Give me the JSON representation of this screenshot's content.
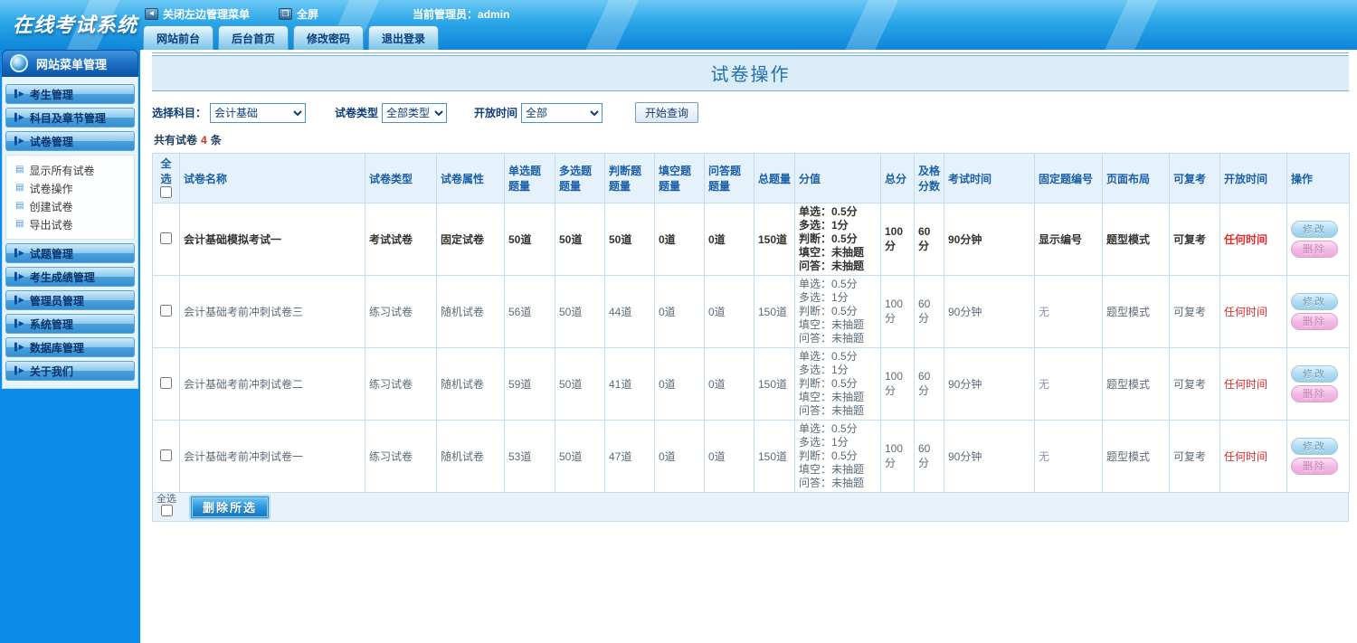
{
  "colors": {
    "topbar": "#1694e0",
    "sidebar": "#0a8ce8",
    "accent_red": "#e02b2b",
    "title_blue": "#2270ae"
  },
  "header": {
    "logo": "在线考试系统",
    "collapse_menu": "关闭左边管理菜单",
    "fullscreen": "全屏",
    "admin_text": "当前管理员：admin",
    "tabs": [
      "网站前台",
      "后台首页",
      "修改密码",
      "退出登录"
    ]
  },
  "sidebar": {
    "title": "网站菜单管理",
    "items": [
      "考生管理",
      "科目及章节管理",
      "试卷管理",
      "试题管理",
      "考生成绩管理",
      "管理员管理",
      "系统管理",
      "数据库管理",
      "关于我们"
    ],
    "submenu": [
      "显示所有试卷",
      "试卷操作",
      "创建试卷",
      "导出试卷"
    ]
  },
  "main": {
    "title": "试卷操作",
    "filters": {
      "subject_label": "选择科目：",
      "subject_value": "会计基础",
      "type_label": "试卷类型",
      "type_value": "全部类型",
      "time_label": "开放时间",
      "time_value": "全部",
      "query_button": "开始查询"
    },
    "count": {
      "prefix": "共有试卷",
      "number": "4",
      "suffix": "条"
    },
    "table": {
      "headers": [
        "全选",
        "试卷名称",
        "试卷类型",
        "试卷属性",
        "单选题题量",
        "多选题题量",
        "判断题题量",
        "填空题题量",
        "问答题题量",
        "总题量",
        "分值",
        "总分",
        "及格分数",
        "考试时间",
        "固定题编号",
        "页面布局",
        "可复考",
        "开放时间",
        "操作"
      ],
      "edit_label": "修改",
      "delete_label": "删除",
      "rows": [
        {
          "name": "会计基础模拟考试一",
          "type": "考试试卷",
          "attr": "固定试卷",
          "single": "50道",
          "multi": "50道",
          "judge": "50道",
          "blank": "0道",
          "qa": "0道",
          "total_q": "150道",
          "scores": "单选：0.5分\n多选：1分\n判断：0.5分\n填空：未抽题\n问答：未抽题",
          "total_score": "100分",
          "pass_score": "60分",
          "duration": "90分钟",
          "fixed_num": "显示编号",
          "layout": "题型模式",
          "retake": "可复考",
          "open_time": "任何时间"
        },
        {
          "name": "会计基础考前冲刺试卷三",
          "type": "练习试卷",
          "attr": "随机试卷",
          "single": "56道",
          "multi": "50道",
          "judge": "44道",
          "blank": "0道",
          "qa": "0道",
          "total_q": "150道",
          "scores": "单选：0.5分\n多选：1分\n判断：0.5分\n填空：未抽题\n问答：未抽题",
          "total_score": "100分",
          "pass_score": "60分",
          "duration": "90分钟",
          "fixed_num": "无",
          "layout": "题型模式",
          "retake": "可复考",
          "open_time": "任何时间"
        },
        {
          "name": "会计基础考前冲刺试卷二",
          "type": "练习试卷",
          "attr": "随机试卷",
          "single": "59道",
          "multi": "50道",
          "judge": "41道",
          "blank": "0道",
          "qa": "0道",
          "total_q": "150道",
          "scores": "单选：0.5分\n多选：1分\n判断：0.5分\n填空：未抽题\n问答：未抽题",
          "total_score": "100分",
          "pass_score": "60分",
          "duration": "90分钟",
          "fixed_num": "无",
          "layout": "题型模式",
          "retake": "可复考",
          "open_time": "任何时间"
        },
        {
          "name": "会计基础考前冲刺试卷一",
          "type": "练习试卷",
          "attr": "随机试卷",
          "single": "53道",
          "multi": "50道",
          "judge": "47道",
          "blank": "0道",
          "qa": "0道",
          "total_q": "150道",
          "scores": "单选：0.5分\n多选：1分\n判断：0.5分\n填空：未抽题\n问答：未抽题",
          "total_score": "100分",
          "pass_score": "60分",
          "duration": "90分钟",
          "fixed_num": "无",
          "layout": "题型模式",
          "retake": "可复考",
          "open_time": "任何时间"
        }
      ],
      "footer": {
        "select_all": "全选",
        "delete_selected": "删除所选"
      }
    }
  }
}
